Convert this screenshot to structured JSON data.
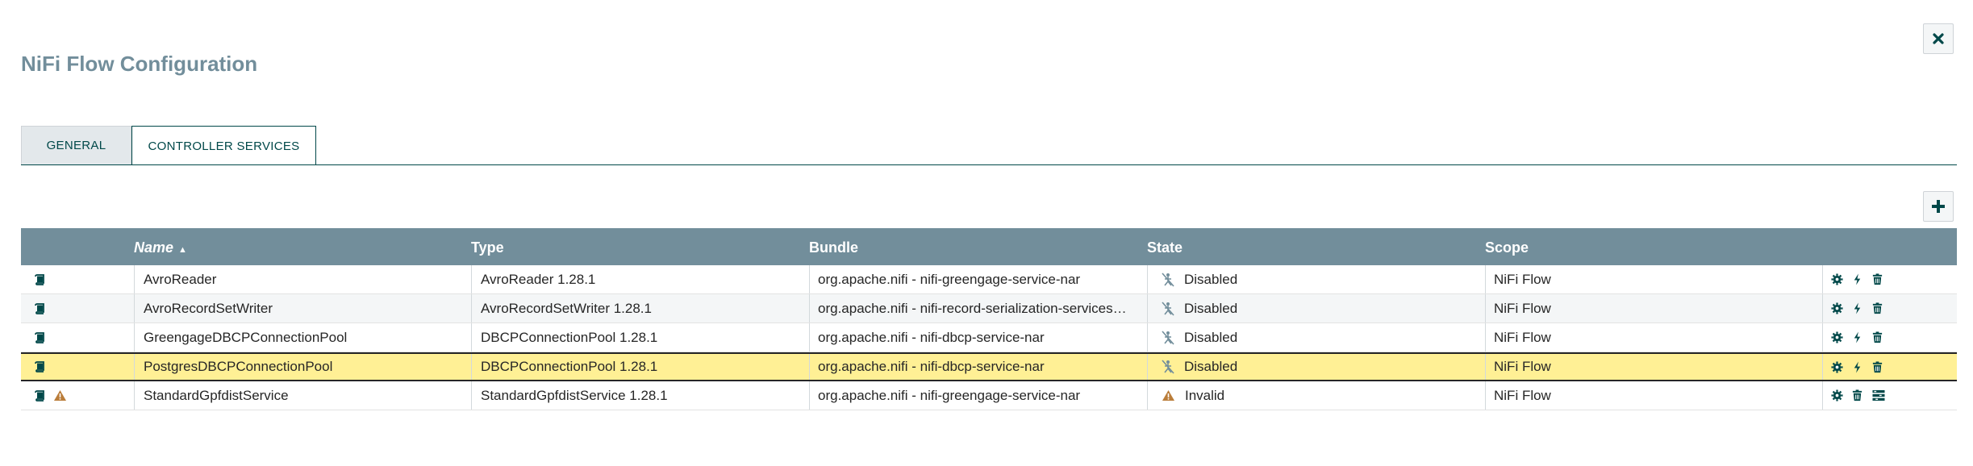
{
  "dialog": {
    "title": "NiFi Flow Configuration",
    "close_icon": "close-icon"
  },
  "tabs": [
    {
      "label": "GENERAL",
      "active": false
    },
    {
      "label": "CONTROLLER SERVICES",
      "active": true
    }
  ],
  "toolbar": {
    "add_icon": "plus-icon"
  },
  "table": {
    "columns": {
      "name": "Name",
      "type": "Type",
      "bundle": "Bundle",
      "state": "State",
      "scope": "Scope"
    },
    "sort": {
      "column": "Name",
      "direction": "ascending"
    },
    "rows": [
      {
        "name": "AvroReader",
        "type": "AvroReader 1.28.1",
        "bundle": "org.apache.nifi - nifi-greengage-service-nar",
        "state": "Disabled",
        "scope": "NiFi Flow",
        "warning": false,
        "actions": [
          "gear-icon",
          "bolt-icon",
          "trash-icon"
        ]
      },
      {
        "name": "AvroRecordSetWriter",
        "type": "AvroRecordSetWriter 1.28.1",
        "bundle": "org.apache.nifi - nifi-record-serialization-services…",
        "state": "Disabled",
        "scope": "NiFi Flow",
        "warning": false,
        "actions": [
          "gear-icon",
          "bolt-icon",
          "trash-icon"
        ]
      },
      {
        "name": "GreengageDBCPConnectionPool",
        "type": "DBCPConnectionPool 1.28.1",
        "bundle": "org.apache.nifi - nifi-dbcp-service-nar",
        "state": "Disabled",
        "scope": "NiFi Flow",
        "warning": false,
        "actions": [
          "gear-icon",
          "bolt-icon",
          "trash-icon"
        ]
      },
      {
        "name": "PostgresDBCPConnectionPool",
        "type": "DBCPConnectionPool 1.28.1",
        "bundle": "org.apache.nifi - nifi-dbcp-service-nar",
        "state": "Disabled",
        "scope": "NiFi Flow",
        "warning": false,
        "selected": true,
        "actions": [
          "gear-icon",
          "bolt-icon",
          "trash-icon"
        ]
      },
      {
        "name": "StandardGpfdistService",
        "type": "StandardGpfdistService 1.28.1",
        "bundle": "org.apache.nifi - nifi-greengage-service-nar",
        "state": "Invalid",
        "scope": "NiFi Flow",
        "warning": true,
        "actions": [
          "gear-icon",
          "trash-icon",
          "settings-list-icon"
        ]
      }
    ]
  },
  "colors": {
    "header_bg": "#728e9b",
    "accent": "#004849",
    "selected_row": "#fff095",
    "warning": "#ba554a"
  }
}
